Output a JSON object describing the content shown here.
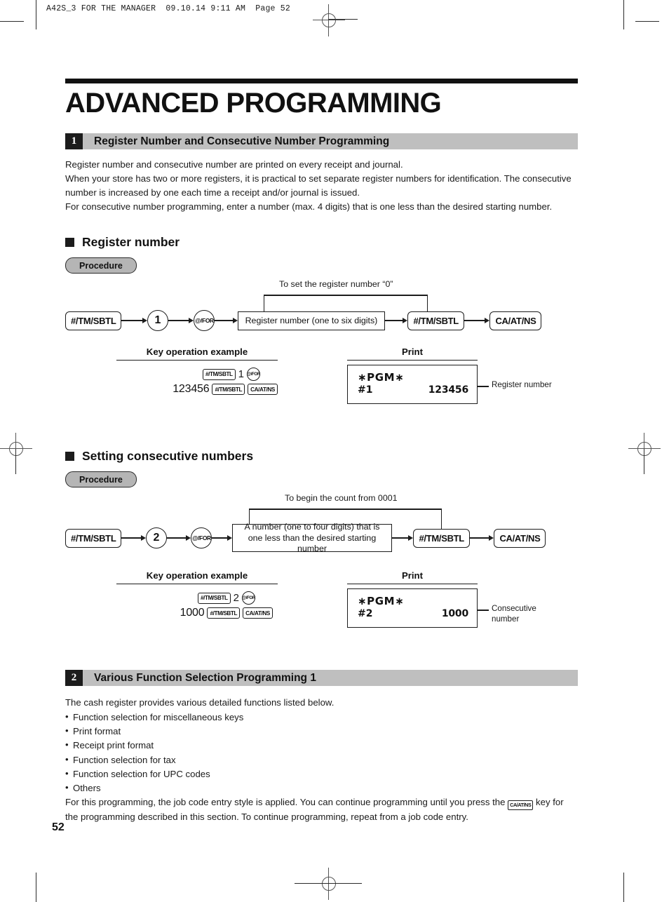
{
  "running_head": "A42S_3 FOR THE MANAGER  09.10.14 9:11 AM  Page 52",
  "page_title": "ADVANCED PROGRAMMING",
  "folio": "52",
  "sections": [
    {
      "number": "1",
      "title": "Register Number and Consecutive Number Programming",
      "paragraphs": [
        "Register number and consecutive number are printed on every receipt and journal.",
        "When your store has two or more registers, it is practical to set separate register numbers for identification.  The consecutive number is increased by one each time a receipt and/or journal is issued.",
        "For consecutive number programming, enter a number (max. 4 digits) that is one less than the desired starting number."
      ]
    },
    {
      "number": "2",
      "title": "Various Function Selection Programming 1",
      "intro": "The cash register provides various detailed functions listed below.",
      "bullets": [
        "Function selection for miscellaneous keys",
        "Print format",
        "Receipt print format",
        "Function selection for tax",
        "Function selection for UPC codes",
        "Others"
      ],
      "outro_a": "For this programming, the job code entry style is applied.  You can continue programming until you press the",
      "outro_key": "CA/AT/NS",
      "outro_b": "key for the programming described in this section.  To continue programming, repeat from a job code entry."
    }
  ],
  "subsections": [
    {
      "heading": "Register number",
      "procedure_label": "Procedure",
      "bypass_label": "To set the register number “0”",
      "flow": {
        "key1": "#/TM/SBTL",
        "digit": "1",
        "forkey": "@/FOR",
        "entry": "Register number (one to six digits)",
        "key2": "#/TM/SBTL",
        "key3": "CA/AT/NS"
      },
      "example_header": "Key operation example",
      "print_header": "Print",
      "example": {
        "row1_key": "#/TM/SBTL",
        "row1_digit": "1",
        "row1_forkey": "@/FOR",
        "row2_amount": "123456",
        "row2_key1": "#/TM/SBTL",
        "row2_key2": "CA/AT/NS"
      },
      "receipt": {
        "pgm": "∗PGM∗",
        "id": "#1",
        "value": "123456"
      },
      "callout": "Register number"
    },
    {
      "heading": "Setting consecutive numbers",
      "procedure_label": "Procedure",
      "bypass_label": "To begin the count from 0001",
      "flow": {
        "key1": "#/TM/SBTL",
        "digit": "2",
        "forkey": "@/FOR",
        "entry": "A number (one to four digits) that is one less than the desired starting number",
        "key2": "#/TM/SBTL",
        "key3": "CA/AT/NS"
      },
      "example_header": "Key operation example",
      "print_header": "Print",
      "example": {
        "row1_key": "#/TM/SBTL",
        "row1_digit": "2",
        "row1_forkey": "@/FOR",
        "row2_amount": "1000",
        "row2_key1": "#/TM/SBTL",
        "row2_key2": "CA/AT/NS"
      },
      "receipt": {
        "pgm": "∗PGM∗",
        "id": "#2",
        "value": "1000"
      },
      "callout": "Consecutive\nnumber"
    }
  ]
}
